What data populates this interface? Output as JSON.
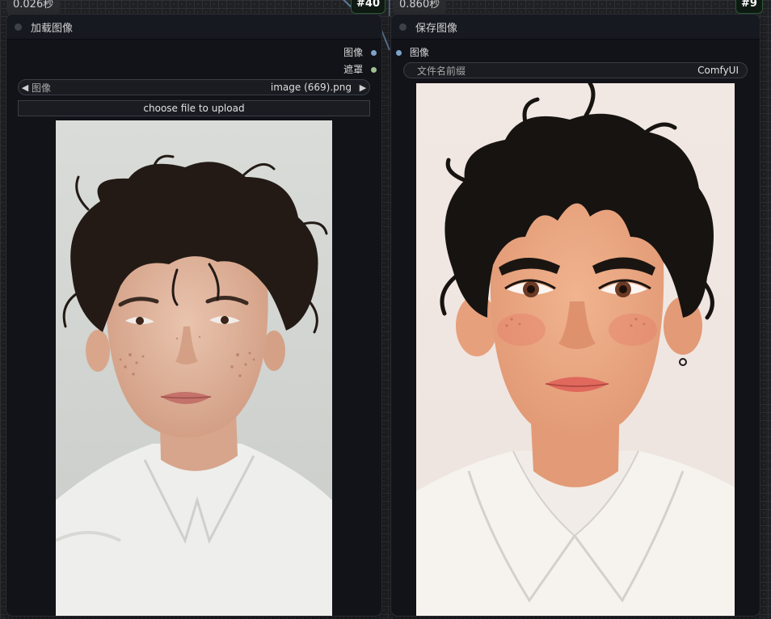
{
  "load_node": {
    "exec_time": "0.026秒",
    "id": "#40",
    "title": "加载图像",
    "outputs": [
      {
        "label": "图像",
        "color": "#7fa2c8"
      },
      {
        "label": "遮罩",
        "color": "#9fc090"
      }
    ],
    "image_widget": {
      "label": "图像",
      "value": "image (669).png"
    },
    "upload_label": "choose file to upload"
  },
  "save_node": {
    "exec_time": "0.860秒",
    "id": "#9",
    "title": "保存图像",
    "input": {
      "label": "图像",
      "color": "#7fa2c8"
    },
    "filename_widget": {
      "label": "文件名前缀",
      "value": "ComfyUI"
    }
  }
}
